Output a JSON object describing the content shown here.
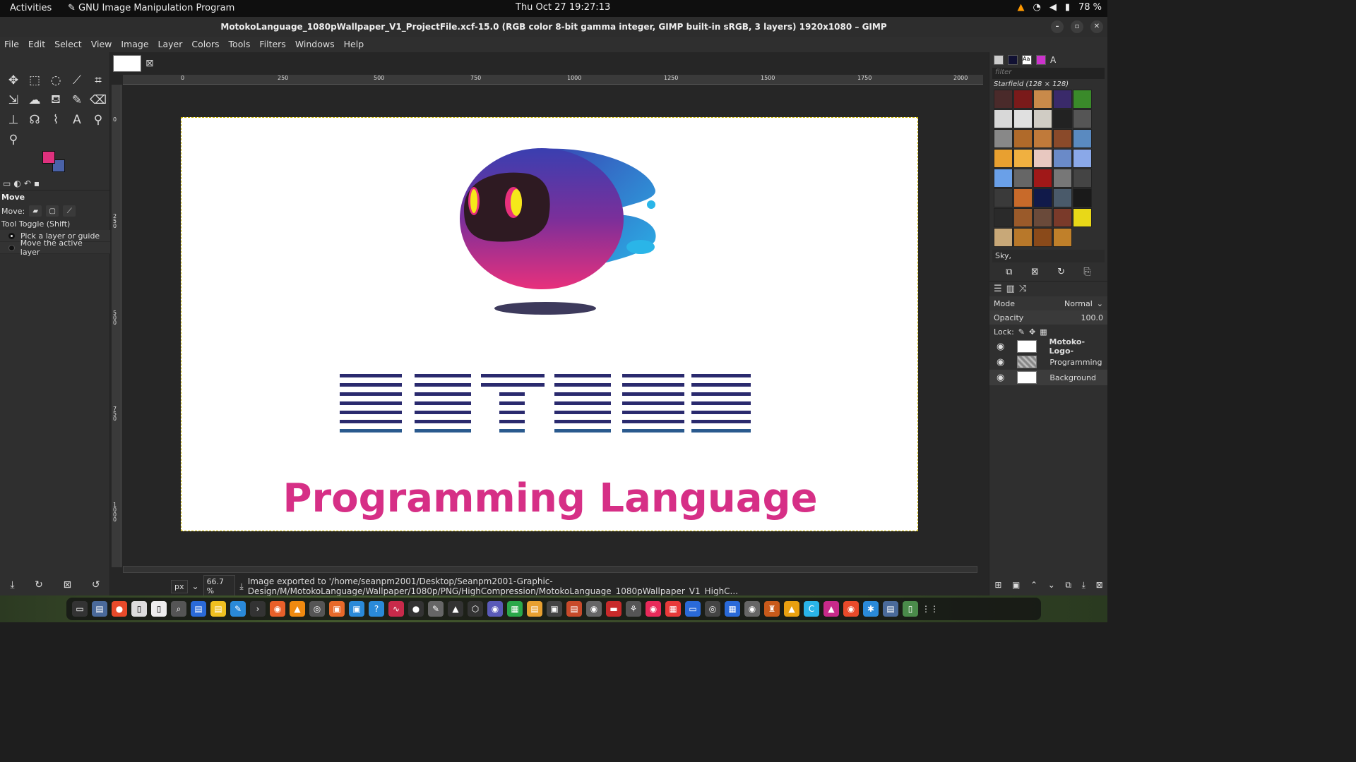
{
  "topbar": {
    "activities": "Activities",
    "app": "GNU Image Manipulation Program",
    "clock": "Thu Oct 27  19:27:13",
    "battery": "78 %"
  },
  "titlebar": {
    "title": "MotokoLanguage_1080pWallpaper_V1_ProjectFile.xcf-15.0 (RGB color 8-bit gamma integer, GIMP built-in sRGB, 3 layers) 1920x1080 – GIMP"
  },
  "menu": [
    "File",
    "Edit",
    "Select",
    "View",
    "Image",
    "Layer",
    "Colors",
    "Tools",
    "Filters",
    "Windows",
    "Help"
  ],
  "colors": {
    "fg": "#e0317e",
    "bg": "#4a62a8"
  },
  "tool_options": {
    "title": "Move",
    "move_label": "Move:",
    "toggle": "Tool Toggle  (Shift)",
    "opt1": "Pick a layer or guide",
    "opt2": "Move the active layer"
  },
  "ruler_h": [
    "0",
    "250",
    "500",
    "750",
    "1000",
    "1250",
    "1500",
    "1750",
    "2000"
  ],
  "ruler_v": [
    "0",
    "250",
    "500",
    "750",
    "1000"
  ],
  "image": {
    "wordmark": "MOTOKO",
    "subtitle": "Programming Language",
    "subtitle_color": "#d62f86",
    "wordmark_color": "#2a2a6e"
  },
  "status": {
    "unit": "px",
    "zoom": "66.7 %",
    "message": "Image exported to '/home/seanpm2001/Desktop/Seanpm2001-Graphic-Design/M/MotokoLanguage/Wallpaper/1080p/PNG/HighCompression/MotokoLanguage_1080pWallpaper_V1_HighC..."
  },
  "patterns": {
    "filter": "filter",
    "name": "Starfield (128 × 128)",
    "tag": "Sky,"
  },
  "layers_panel": {
    "mode_label": "Mode",
    "mode": "Normal",
    "opacity_label": "Opacity",
    "opacity": "100.0",
    "lock_label": "Lock:",
    "layers": [
      "Motoko-Logo-",
      "Programming",
      "Background"
    ]
  }
}
